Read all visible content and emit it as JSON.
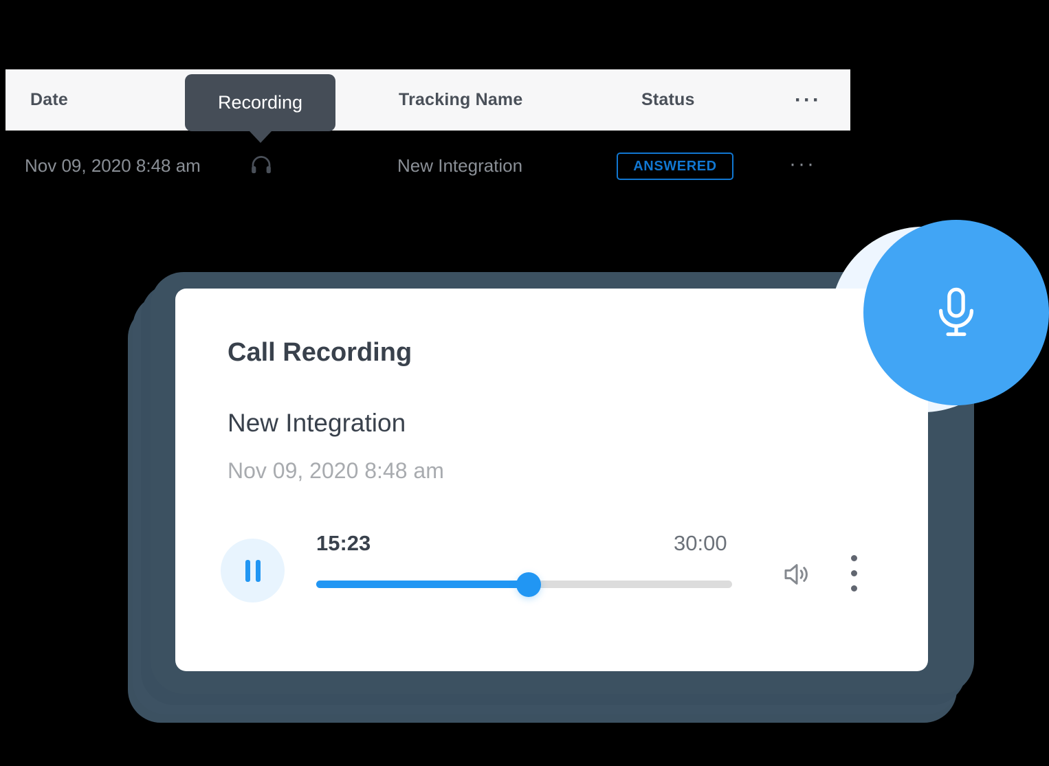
{
  "table": {
    "headers": {
      "date": "Date",
      "tracking_name": "Tracking Name",
      "status": "Status",
      "more": "···"
    },
    "row": {
      "date": "Nov 09, 2020 8:48 am",
      "recording_icon": "headphones-icon",
      "tracking_name": "New Integration",
      "status": "ANSWERED",
      "status_color": "#1177d1",
      "more": "···"
    }
  },
  "tooltip": {
    "label": "Recording",
    "background": "#454d57"
  },
  "player_card": {
    "title": "Call Recording",
    "subtitle": "New Integration",
    "date": "Nov 09, 2020 8:48 am",
    "controls": {
      "play_pause_icon": "pause-icon",
      "current_time": "15:23",
      "total_time": "30:00",
      "progress_percent": 51,
      "volume_icon": "volume-up-icon",
      "menu_icon": "kebab-menu-icon"
    },
    "accent_color": "#2196f3"
  },
  "mic_badge": {
    "icon": "microphone-icon",
    "color": "#41a5f5",
    "halo_color": "#eef6ff"
  }
}
